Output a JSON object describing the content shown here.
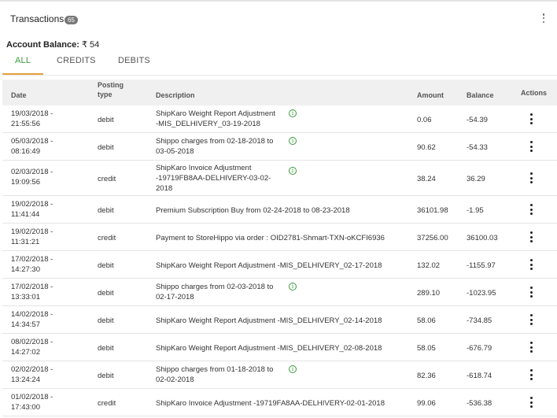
{
  "header": {
    "title": "Transactions",
    "count": "65"
  },
  "balance": {
    "label": "Account Balance:",
    "value": "₹ 54"
  },
  "tabs": [
    {
      "label": "ALL",
      "active": true
    },
    {
      "label": "CREDITS",
      "active": false
    },
    {
      "label": "DEBITS",
      "active": false
    }
  ],
  "columns": {
    "date": "Date",
    "posting_type_1": "Posting",
    "posting_type_2": "type",
    "description": "Description",
    "amount": "Amount",
    "balance": "Balance",
    "actions": "Actions"
  },
  "rows": [
    {
      "date1": "19/03/2018 -",
      "date2": "21:55:56",
      "type": "debit",
      "desc1": "ShipKaro Weight Report Adjustment",
      "desc2": "-MIS_DELHIVERY_03-19-2018",
      "desc3": "",
      "info": true,
      "amount": "0.06",
      "balance": "-54.39"
    },
    {
      "date1": "05/03/2018 -",
      "date2": "08:16:49",
      "type": "debit",
      "desc1": "Shippo charges from 02-18-2018 to",
      "desc2": "03-05-2018",
      "desc3": "",
      "info": true,
      "amount": "90.62",
      "balance": "-54.33"
    },
    {
      "date1": "02/03/2018 -",
      "date2": "19:09:56",
      "type": "credit",
      "desc1": "ShipKaro Invoice Adjustment",
      "desc2": "-19719FB8AA-DELHIVERY-03-02-",
      "desc3": "2018",
      "info": true,
      "amount": "38.24",
      "balance": "36.29"
    },
    {
      "date1": "19/02/2018 -",
      "date2": "11:41:44",
      "type": "debit",
      "desc1": "Premium Subscription Buy from 02-24-2018 to 08-23-2018",
      "desc2": "",
      "desc3": "",
      "info": false,
      "amount": "36101.98",
      "balance": "-1.95"
    },
    {
      "date1": "19/02/2018 -",
      "date2": "11:31:21",
      "type": "credit",
      "desc1": "Payment to StoreHippo via order : OID2781-Shmart-TXN-oKCFI6936",
      "desc2": "",
      "desc3": "",
      "info": false,
      "amount": "37256.00",
      "balance": "36100.03"
    },
    {
      "date1": "17/02/2018 -",
      "date2": "14:27:30",
      "type": "debit",
      "desc1": "ShipKaro Weight Report Adjustment -MIS_DELHIVERY_02-17-2018",
      "desc2": "",
      "desc3": "",
      "info": false,
      "amount": "132.02",
      "balance": "-1155.97"
    },
    {
      "date1": "17/02/2018 -",
      "date2": "13:33:01",
      "type": "debit",
      "desc1": "Shippo charges from 02-03-2018 to",
      "desc2": "02-17-2018",
      "desc3": "",
      "info": true,
      "amount": "289.10",
      "balance": "-1023.95"
    },
    {
      "date1": "14/02/2018 -",
      "date2": "14:34:57",
      "type": "debit",
      "desc1": "ShipKaro Weight Report Adjustment -MIS_DELHIVERY_02-14-2018",
      "desc2": "",
      "desc3": "",
      "info": false,
      "amount": "58.06",
      "balance": "-734.85"
    },
    {
      "date1": "08/02/2018 -",
      "date2": "14:27:02",
      "type": "debit",
      "desc1": "ShipKaro Weight Report Adjustment -MIS_DELHIVERY_02-08-2018",
      "desc2": "",
      "desc3": "",
      "info": false,
      "amount": "58.05",
      "balance": "-676.79"
    },
    {
      "date1": "02/02/2018 -",
      "date2": "13:24:24",
      "type": "debit",
      "desc1": "Shippo charges from 01-18-2018 to",
      "desc2": "02-02-2018",
      "desc3": "",
      "info": true,
      "amount": "82.36",
      "balance": "-618.74"
    },
    {
      "date1": "01/02/2018 -",
      "date2": "17:43:00",
      "type": "credit",
      "desc1": "ShipKaro Invoice Adjustment -19719FA8AA-DELHIVERY-02-01-2018",
      "desc2": "",
      "desc3": "",
      "info": false,
      "amount": "99.06",
      "balance": "-536.38"
    }
  ],
  "icons": {
    "info": "info-circle-icon",
    "more": "more-vertical-icon"
  },
  "colors": {
    "accent_green": "#3a9b3a",
    "tab_underline": "#e6a23c",
    "badge": "#777777"
  }
}
